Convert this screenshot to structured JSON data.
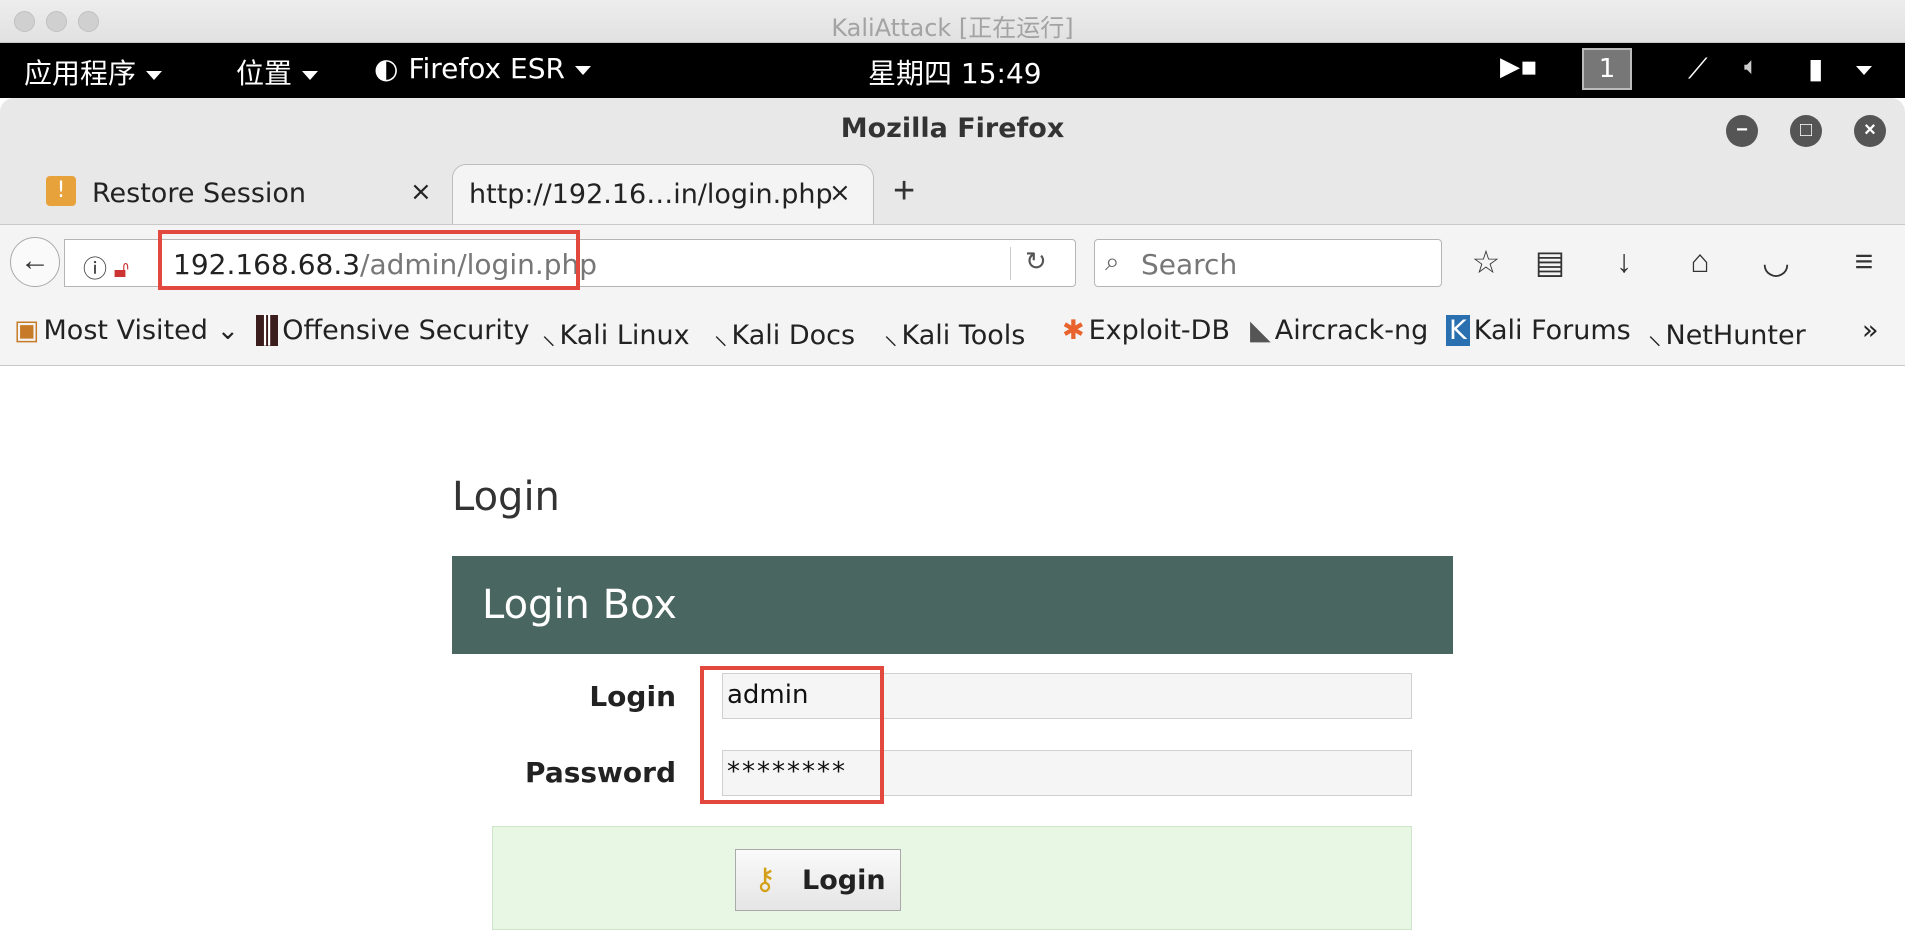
{
  "os": {
    "window_title": "KaliAttack [正在运行]",
    "panel": {
      "applications": "应用程序",
      "places": "位置",
      "active_app": "Firefox ESR",
      "clock": "星期四 15:49",
      "workspace": "1"
    }
  },
  "browser": {
    "window_title": "Mozilla Firefox",
    "tabs": [
      {
        "label": "Restore Session"
      },
      {
        "label": "http://192.16…in/login.php"
      }
    ],
    "url": {
      "host": "192.168.68.3",
      "path": "/admin/login.php"
    },
    "search_placeholder": "Search",
    "bookmarks": [
      {
        "label": "Most Visited"
      },
      {
        "label": "Offensive Security"
      },
      {
        "label": "Kali Linux"
      },
      {
        "label": "Kali Docs"
      },
      {
        "label": "Kali Tools"
      },
      {
        "label": "Exploit-DB"
      },
      {
        "label": "Aircrack-ng"
      },
      {
        "label": "Kali Forums"
      },
      {
        "label": "NetHunter"
      }
    ],
    "overflow": "»"
  },
  "page": {
    "title": "Login",
    "box_title": "Login Box",
    "login_label": "Login",
    "login_value": "admin",
    "password_label": "Password",
    "password_value": "********",
    "submit_label": "Login"
  },
  "colors": {
    "box_header": "#4a6660",
    "highlight": "#e2483e",
    "button_area": "#e8f7e4"
  }
}
